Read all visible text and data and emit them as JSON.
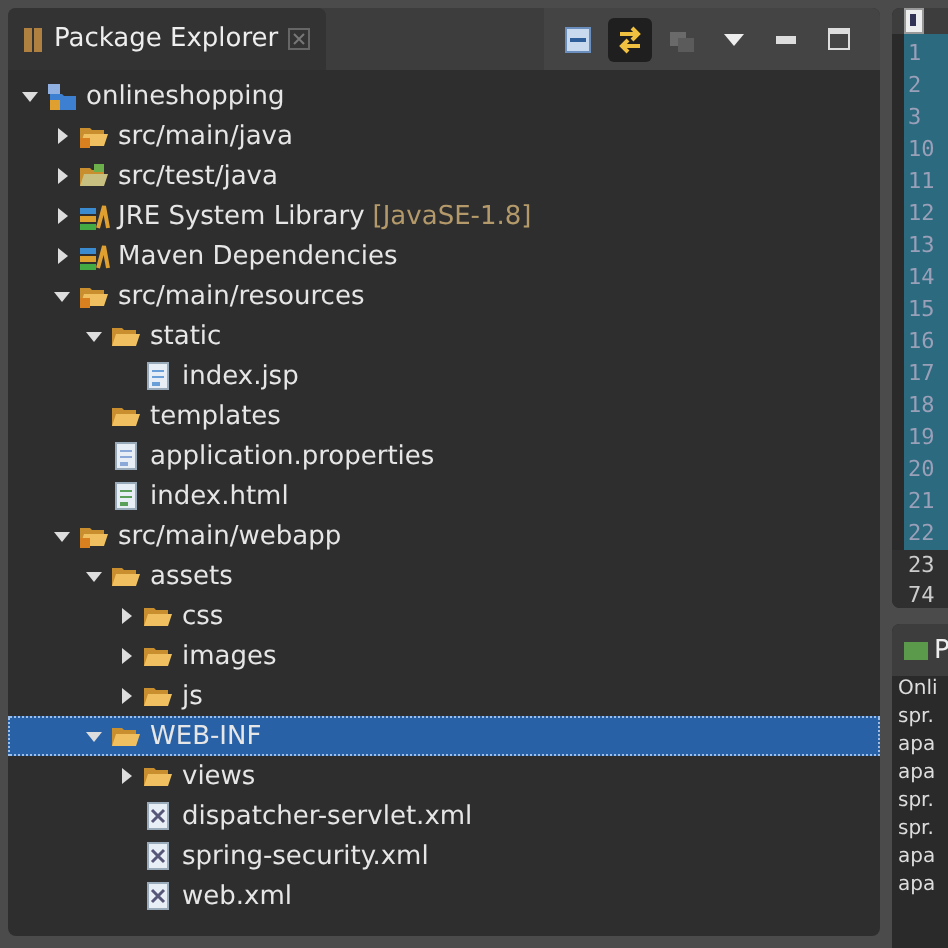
{
  "view": {
    "title": "Package Explorer",
    "toolbar": [
      {
        "kind": "collapse",
        "selected": false,
        "disabled": false
      },
      {
        "kind": "link",
        "selected": true,
        "disabled": false
      },
      {
        "kind": "filter",
        "selected": false,
        "disabled": true
      },
      {
        "kind": "menu",
        "selected": false,
        "disabled": false
      },
      {
        "kind": "minimize",
        "selected": false,
        "disabled": false
      },
      {
        "kind": "maximize",
        "selected": false,
        "disabled": false
      }
    ]
  },
  "tree": [
    {
      "label": "onlineshopping",
      "kind": "project",
      "expanded": true,
      "selected": false,
      "children": [
        {
          "label": "src/main/java",
          "kind": "source",
          "expanded": false,
          "selected": false
        },
        {
          "label": "src/test/java",
          "kind": "testsource",
          "expanded": false,
          "selected": false
        },
        {
          "label": "JRE System Library",
          "decoration": "[JavaSE-1.8]",
          "kind": "library",
          "expanded": false,
          "selected": false
        },
        {
          "label": "Maven Dependencies",
          "kind": "library",
          "expanded": false,
          "selected": false
        },
        {
          "label": "src/main/resources",
          "kind": "source",
          "expanded": true,
          "selected": false,
          "children": [
            {
              "label": "static",
              "kind": "folder",
              "expanded": true,
              "selected": false,
              "children": [
                {
                  "label": "index.jsp",
                  "kind": "jsp",
                  "selected": false
                }
              ]
            },
            {
              "label": "templates",
              "kind": "folder",
              "selected": false
            },
            {
              "label": "application.properties",
              "kind": "text",
              "selected": false
            },
            {
              "label": "index.html",
              "kind": "html",
              "selected": false
            }
          ]
        },
        {
          "label": "src/main/webapp",
          "kind": "source",
          "expanded": true,
          "selected": false,
          "children": [
            {
              "label": "assets",
              "kind": "folder",
              "expanded": true,
              "selected": false,
              "children": [
                {
                  "label": "css",
                  "kind": "folder",
                  "expanded": false,
                  "selected": false
                },
                {
                  "label": "images",
                  "kind": "folder",
                  "expanded": false,
                  "selected": false
                },
                {
                  "label": "js",
                  "kind": "folder",
                  "expanded": false,
                  "selected": false
                }
              ]
            },
            {
              "label": "WEB-INF",
              "kind": "folder",
              "expanded": true,
              "selected": true,
              "children": [
                {
                  "label": "views",
                  "kind": "folder",
                  "expanded": false,
                  "selected": false
                },
                {
                  "label": "dispatcher-servlet.xml",
                  "kind": "xml",
                  "selected": false
                },
                {
                  "label": "spring-security.xml",
                  "kind": "xml",
                  "selected": false
                },
                {
                  "label": "web.xml",
                  "kind": "xml",
                  "selected": false
                }
              ]
            }
          ]
        }
      ]
    }
  ],
  "editor": {
    "line_numbers": [
      "1",
      "2",
      "3",
      "10",
      "11",
      "12",
      "13",
      "14",
      "15",
      "16",
      "17",
      "18",
      "19",
      "20",
      "21",
      "22"
    ],
    "footer_numbers": [
      "23",
      "74"
    ]
  },
  "console": {
    "title": "P",
    "lines": [
      "Onli",
      "spr.",
      "apa",
      "apa",
      "spr.",
      "spr.",
      "apa",
      "apa"
    ]
  }
}
